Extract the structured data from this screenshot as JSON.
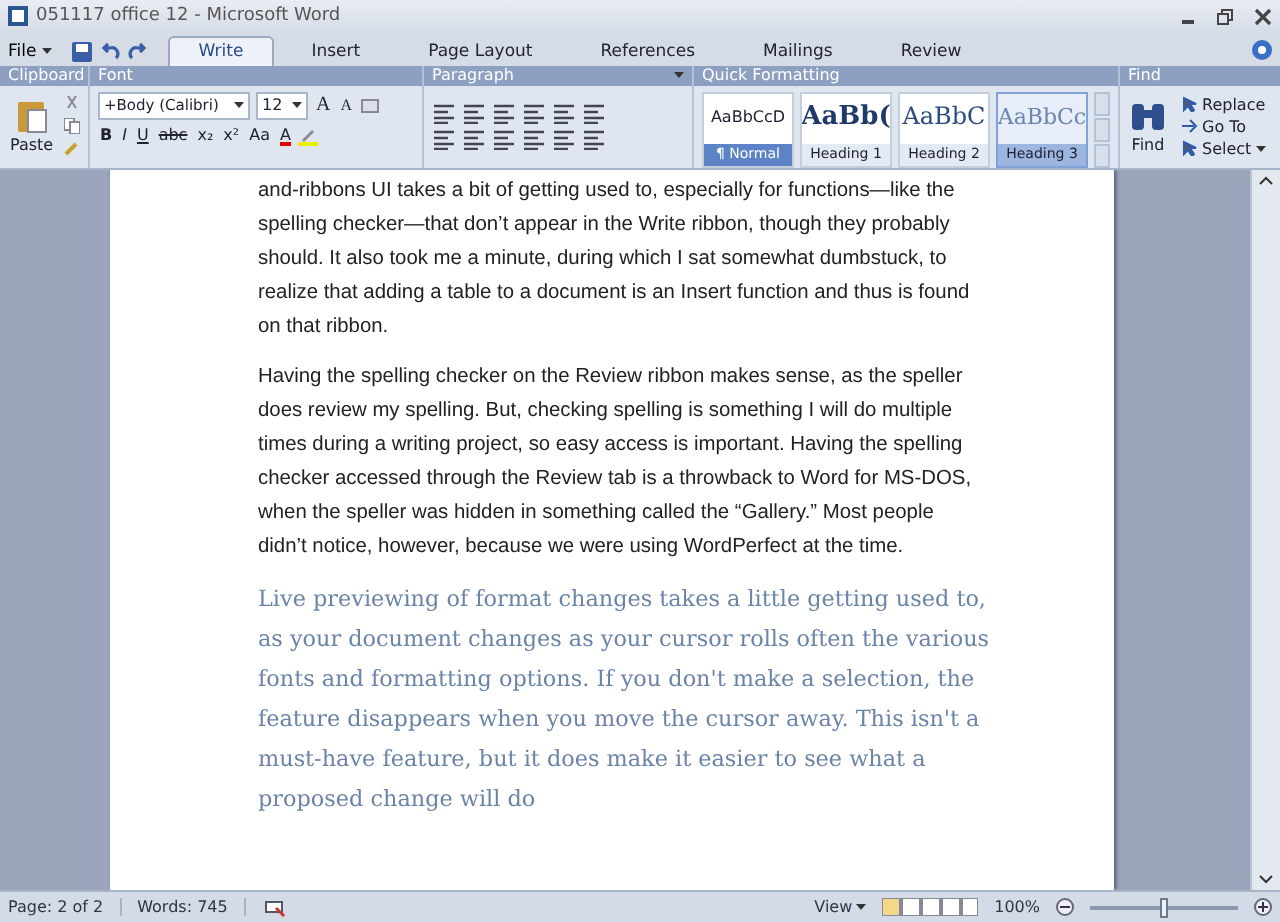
{
  "window": {
    "title": "051117 office 12 - Microsoft Word"
  },
  "file_menu": {
    "label": "File"
  },
  "tabs": [
    {
      "label": "Write",
      "selected": true
    },
    {
      "label": "Insert",
      "selected": false
    },
    {
      "label": "Page Layout",
      "selected": false
    },
    {
      "label": "References",
      "selected": false
    },
    {
      "label": "Mailings",
      "selected": false
    },
    {
      "label": "Review",
      "selected": false
    }
  ],
  "clipboard": {
    "title": "Clipboard",
    "paste": "Paste"
  },
  "font": {
    "title": "Font",
    "font_name": "+Body (Calibri)",
    "font_size": "12",
    "size_buttons": [
      "A",
      "A"
    ],
    "format_buttons": [
      "B",
      "I",
      "U",
      "abc",
      "x₂",
      "x²",
      "Aa"
    ],
    "color_button": "A"
  },
  "paragraph": {
    "title": "Paragraph"
  },
  "quick_formatting": {
    "title": "Quick Formatting",
    "styles": [
      {
        "preview": "AaBbCcD",
        "name": "¶ Normal",
        "kind": "normal",
        "selected": true,
        "hovered": false
      },
      {
        "preview": "AaBb(",
        "name": "Heading 1",
        "kind": "heading1",
        "selected": false,
        "hovered": false
      },
      {
        "preview": "AaBbC",
        "name": "Heading 2",
        "kind": "heading2",
        "selected": false,
        "hovered": false
      },
      {
        "preview": "AaBbCc",
        "name": "Heading 3",
        "kind": "heading3",
        "selected": false,
        "hovered": true
      }
    ]
  },
  "find": {
    "title": "Find",
    "find": "Find",
    "commands": [
      "Replace",
      "Go To",
      "Select"
    ]
  },
  "document": {
    "paragraphs": [
      {
        "kind": "body",
        "text": "and-ribbons UI takes a bit of getting used to, especially for functions—like the spelling checker—that don’t appear in the Write ribbon, though they probably should. It also took me a minute, during which I sat somewhat dumbstuck, to realize that adding a table to a document is an Insert function and thus is found on that ribbon."
      },
      {
        "kind": "body",
        "text": "Having the spelling checker on the Review ribbon makes sense, as the speller does review my spelling. But, checking spelling is something I will do multiple times during a writing project, so easy access is important. Having the spelling checker accessed through the Review tab is a throwback to Word for MS-DOS, when the speller was hidden in something called the “Gallery.” Most people didn’t notice, however, because we were using WordPerfect at the time."
      },
      {
        "kind": "heading3",
        "text": "Live previewing of format changes takes a little getting used to, as your document changes as your cursor rolls often the various fonts and formatting options. If you don't make a selection, the feature disappears when you move the cursor away. This isn't a must-have feature, but it does make it easier to see what a proposed change will do"
      }
    ]
  },
  "status_bar": {
    "page": "Page: 2 of 2",
    "words": "Words: 745",
    "view": "View",
    "zoom": {
      "label": "100%",
      "level": 0.5
    }
  }
}
